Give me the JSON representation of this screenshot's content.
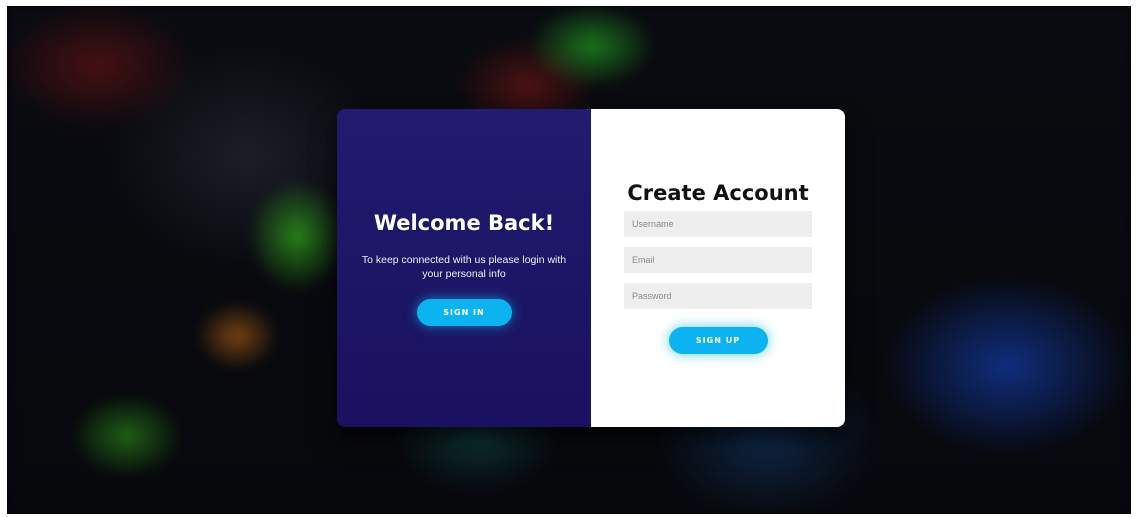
{
  "overlay": {
    "title": "Welcome Back!",
    "text": "To keep connected with us please login with your personal info",
    "button_label": "SIGN IN"
  },
  "signup_form": {
    "title": "Create Account",
    "fields": {
      "username": {
        "placeholder": "Username",
        "value": ""
      },
      "email": {
        "placeholder": "Email",
        "value": ""
      },
      "password": {
        "placeholder": "Password",
        "value": ""
      }
    },
    "button_label": "SIGN UP"
  },
  "colors": {
    "accent": "#0bb4f0",
    "panel": "#1d1566",
    "card": "#ffffff",
    "input_bg": "#eeeeee"
  }
}
